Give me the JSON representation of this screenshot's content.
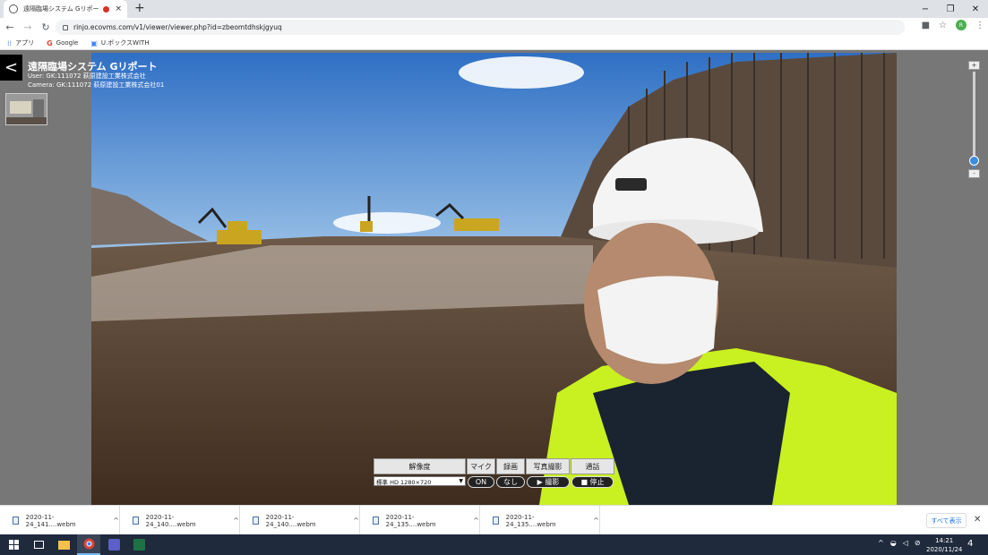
{
  "browser": {
    "tab_title": "遠隔臨場システム Gリポート | G",
    "tab_close": "×",
    "new_tab": "+",
    "url": "rinjo.ecovms.com/v1/viewer/viewer.php?id=zbeomtdhskjgyuq",
    "window_min": "−",
    "window_max": "❐",
    "window_close": "✕",
    "profile_initial": "R",
    "bookmarks": [
      {
        "label": "アプリ",
        "icon": "apps-grid-icon"
      },
      {
        "label": "Google",
        "icon": "google-icon"
      },
      {
        "label": "U.ボックスWITH",
        "icon": "bookmark-page-icon"
      }
    ]
  },
  "viewer": {
    "back_label": "<",
    "title": "遠隔臨場システム Gリポート",
    "user_line": "User: GK:111072 萩原建設工業株式会社",
    "camera_line": "Camera: GK:111072 萩原建設工業株式会社01",
    "zoom_plus": "+",
    "zoom_minus": "-",
    "zoom_level": 0.08
  },
  "controls": {
    "headers": [
      "解像度",
      "マイク",
      "録画",
      "写真撮影",
      "通話"
    ],
    "resolution_selected": "標準 HD 1280×720",
    "buttons": [
      "ON",
      "なし",
      "▶ 撮影",
      "■ 停止"
    ]
  },
  "downloads": {
    "items": [
      "2020-11-24_141....webm",
      "2020-11-24_140....webm",
      "2020-11-24_140....webm",
      "2020-11-24_135....webm",
      "2020-11-24_135....webm"
    ],
    "show_all": "すべて表示",
    "close": "✕"
  },
  "taskbar": {
    "time": "14:21",
    "date": "2020/11/24",
    "notifications": "4"
  },
  "colors": {
    "accent": "#3c8dde",
    "viewer_bg": "#777777",
    "taskbar_bg": "#1f2a3d"
  }
}
